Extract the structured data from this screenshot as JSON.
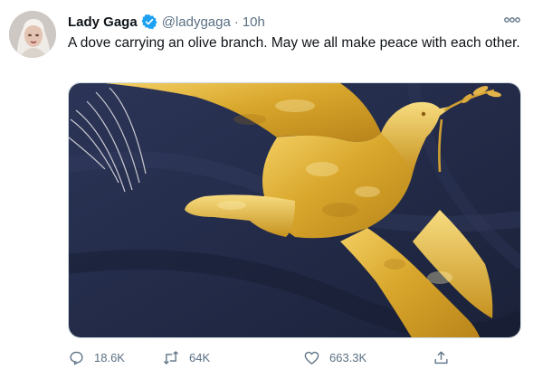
{
  "tweet": {
    "author": {
      "display_name": "Lady Gaga",
      "handle": "@ladygaga",
      "verified": true
    },
    "separator": "·",
    "time": "10h",
    "text": "A dove carrying an olive branch. May we all make peace with each other.",
    "media": {
      "kind": "photo"
    },
    "actions": {
      "reply": {
        "icon": "reply-icon",
        "count": "18.6K"
      },
      "retweet": {
        "icon": "retweet-icon",
        "count": "64K"
      },
      "like": {
        "icon": "heart-icon",
        "count": "663.3K"
      },
      "share": {
        "icon": "share-icon"
      }
    }
  },
  "colors": {
    "text_primary": "#0f1419",
    "text_secondary": "#5b7083",
    "verified_badge": "#1da1f2",
    "border": "#cfd9de"
  }
}
